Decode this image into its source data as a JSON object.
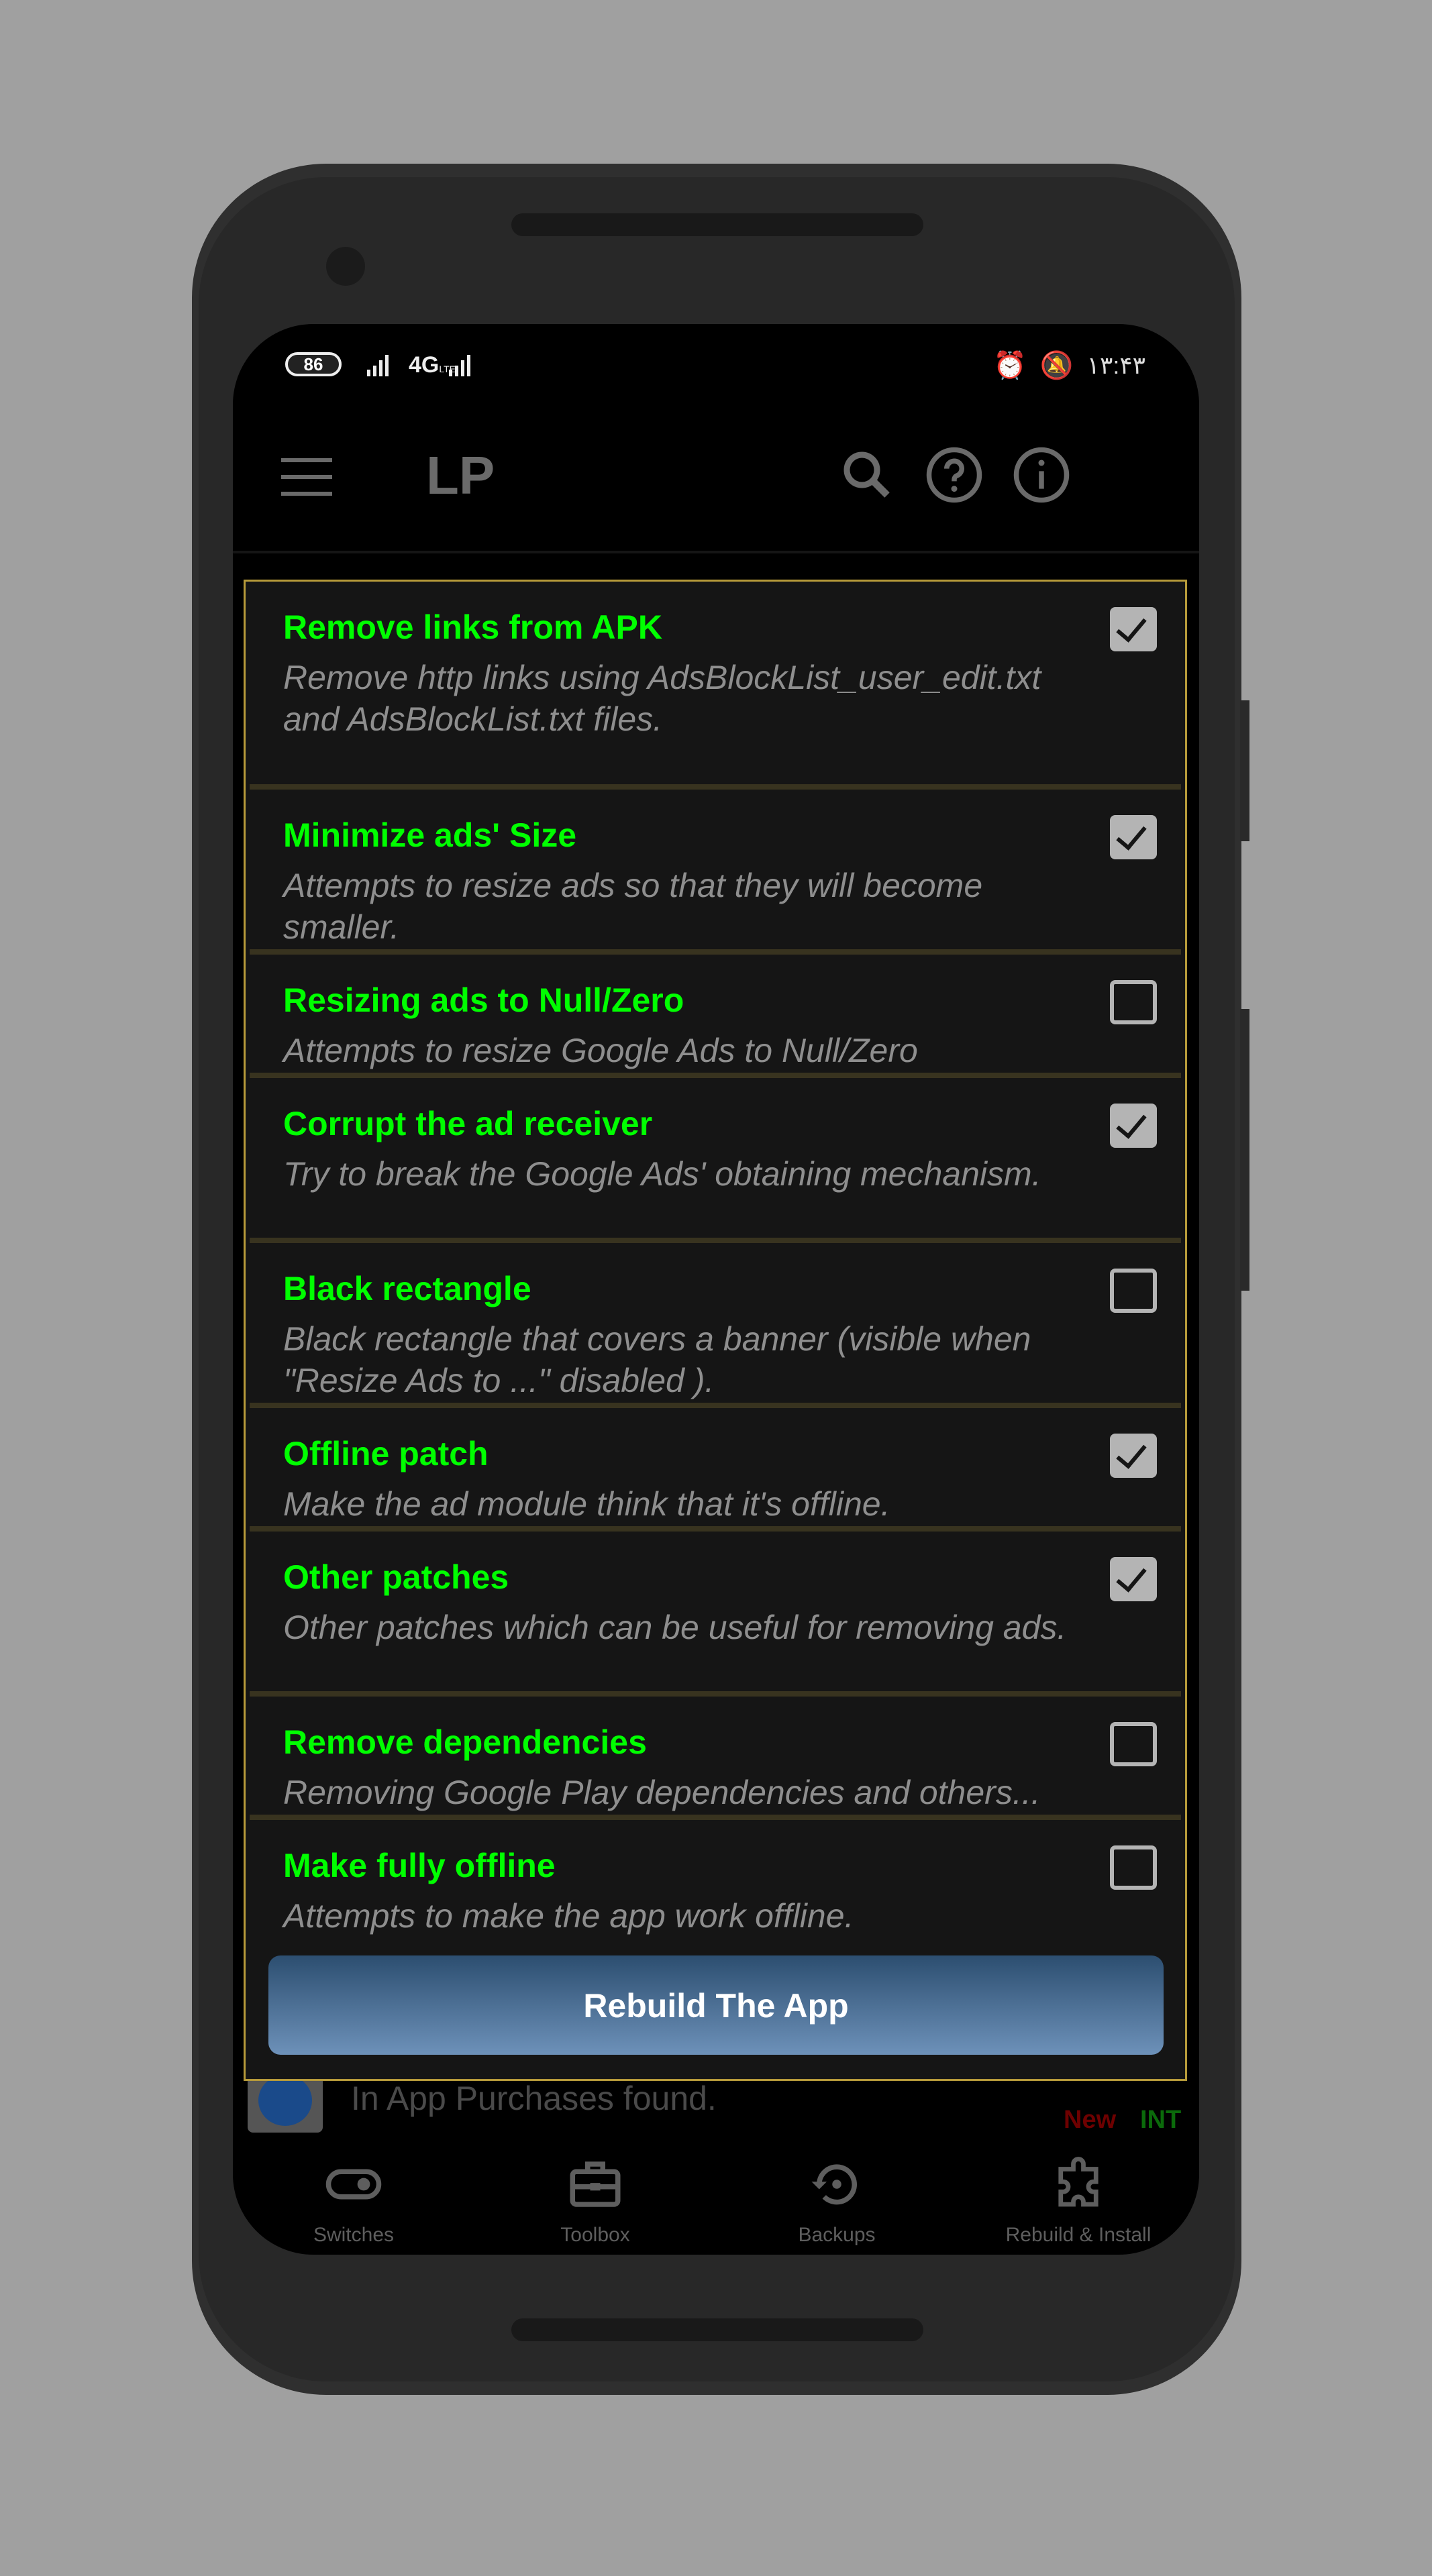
{
  "status_bar": {
    "battery": "86",
    "network": "4G",
    "network_sub": "LTE",
    "time": "۱۳:۴۳",
    "icons": [
      "battery-icon",
      "signal-icon",
      "signal-icon",
      "alarm-icon",
      "mute-icon"
    ]
  },
  "app_bar": {
    "title": "LP",
    "icons": [
      "menu-icon",
      "search-icon",
      "help-icon",
      "info-icon"
    ]
  },
  "dialog": {
    "options": [
      {
        "title": "Remove links from APK",
        "desc": "Remove http links using AdsBlockList_user_edit.txt and AdsBlockList.txt files.",
        "checked": true
      },
      {
        "title": "Minimize ads' Size",
        "desc": "Attempts to resize ads so that they will become smaller.",
        "checked": true
      },
      {
        "title": "Resizing ads to Null/Zero",
        "desc": "Attempts to resize Google Ads to Null/Zero",
        "checked": false
      },
      {
        "title": "Corrupt the ad receiver",
        "desc": "Try to break the Google Ads' obtaining mechanism.",
        "checked": true
      },
      {
        "title": "Black rectangle",
        "desc": "Black rectangle that covers a banner (visible when \"Resize Ads to ...\" disabled ).",
        "checked": false
      },
      {
        "title": "Offline patch",
        "desc": "Make the ad module think that it's offline.",
        "checked": true
      },
      {
        "title": "Other patches",
        "desc": "Other patches which can be useful for removing ads.",
        "checked": true
      },
      {
        "title": "Remove dependencies",
        "desc": "Removing Google Play dependencies and others...",
        "checked": false
      },
      {
        "title": "Make fully offline",
        "desc": "Attempts to make the app work offline.",
        "checked": false
      }
    ],
    "button_label": "Rebuild The App"
  },
  "background_list": {
    "row_text": "In App Purchases found.",
    "tag_new": "New",
    "tag_int": "INT"
  },
  "bottom_nav": {
    "items": [
      {
        "label": "Switches",
        "icon": "toggle-icon"
      },
      {
        "label": "Toolbox",
        "icon": "toolbox-icon"
      },
      {
        "label": "Backups",
        "icon": "restore-icon"
      },
      {
        "label": "Rebuild & Install",
        "icon": "puzzle-icon"
      }
    ]
  },
  "colors": {
    "option_title": "#00ff00",
    "option_desc": "#8e8e8e",
    "dialog_border": "#b69a3a",
    "button_top": "#2c4e70",
    "button_bottom": "#6d91b9"
  }
}
